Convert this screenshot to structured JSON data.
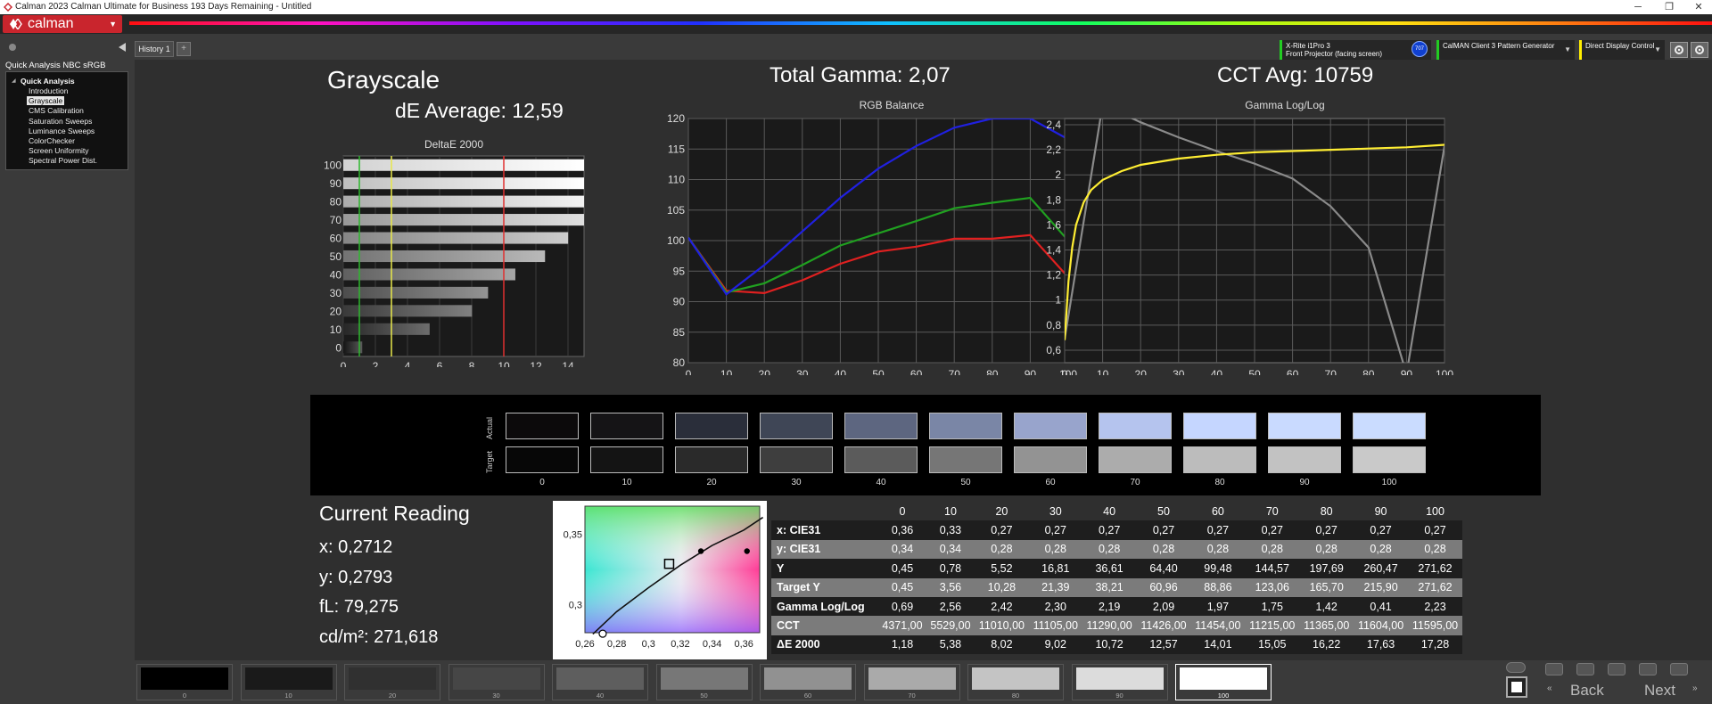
{
  "window": {
    "title": "Calman 2023 Calman Ultimate for Business 193 Days Remaining  - Untitled",
    "minimize": "─",
    "restore": "❐",
    "close": "✕"
  },
  "logo": {
    "text": "calman"
  },
  "left_panel": {
    "section_title": "Quick Analysis NBC sRGB",
    "tree_root": "Quick Analysis",
    "items": [
      {
        "label": "Introduction",
        "selected": false
      },
      {
        "label": "Grayscale",
        "selected": true
      },
      {
        "label": "CMS Calibration",
        "selected": false
      },
      {
        "label": "Saturation Sweeps",
        "selected": false
      },
      {
        "label": "Luminance Sweeps",
        "selected": false
      },
      {
        "label": "ColorChecker",
        "selected": false
      },
      {
        "label": "Screen Uniformity",
        "selected": false
      },
      {
        "label": "Spectral Power Dist.",
        "selected": false
      }
    ]
  },
  "history": {
    "tab_label": "History 1",
    "add_label": "+"
  },
  "devices": {
    "meter_line1": "X-Rite i1Pro 3",
    "meter_line2": "Front Projector (facing screen)",
    "meter_badge": "707",
    "generator": "CalMAN Client 3 Pattern Generator",
    "display": "Direct Display Control"
  },
  "header": {
    "page_title": "Grayscale",
    "de_average": "dE Average: 12,59",
    "total_gamma": "Total Gamma: 2,07",
    "cct_avg": "CCT Avg: 10759"
  },
  "chart_data": [
    {
      "type": "bar",
      "title": "DeltaE 2000",
      "orientation": "horizontal",
      "categories": [
        "100",
        "90",
        "80",
        "70",
        "60",
        "50",
        "40",
        "30",
        "20",
        "10",
        "0"
      ],
      "values": [
        17.28,
        17.63,
        16.22,
        15.05,
        14.01,
        12.57,
        10.72,
        9.02,
        8.02,
        5.38,
        1.18
      ],
      "xlim": [
        0,
        15
      ],
      "x_ticks": [
        "0",
        "2",
        "4",
        "6",
        "8",
        "10",
        "12",
        "14"
      ],
      "reference_lines": [
        {
          "value": 1,
          "color": "#2db82d"
        },
        {
          "value": 3,
          "color": "#e8e84a"
        },
        {
          "value": 10,
          "color": "#e03030"
        }
      ]
    },
    {
      "type": "line",
      "title": "RGB Balance",
      "x": [
        0,
        10,
        20,
        30,
        40,
        50,
        60,
        70,
        80,
        90,
        100
      ],
      "ylim": [
        80,
        120
      ],
      "x_ticks": [
        "0",
        "10",
        "20",
        "30",
        "40",
        "50",
        "60",
        "70",
        "80",
        "90",
        "100"
      ],
      "y_ticks": [
        "80",
        "85",
        "90",
        "95",
        "100",
        "105",
        "110",
        "115",
        "120"
      ],
      "series": [
        {
          "color": "#e02020",
          "values": [
            100.5,
            91.8,
            91.4,
            93.5,
            96.2,
            98.2,
            99.0,
            100.3,
            100.3,
            100.9,
            94.0
          ]
        },
        {
          "color": "#20a020",
          "values": [
            100.5,
            91.5,
            93.0,
            96.0,
            99.2,
            101.2,
            103.2,
            105.3,
            106.2,
            107.0,
            100.0
          ]
        },
        {
          "color": "#2020e0",
          "values": [
            100.5,
            91.2,
            96.0,
            101.5,
            107.0,
            111.8,
            115.5,
            118.5,
            120.0,
            120.0,
            116.6
          ]
        }
      ]
    },
    {
      "type": "line",
      "title": "Gamma Log/Log",
      "x": [
        0,
        10,
        20,
        30,
        40,
        50,
        60,
        70,
        80,
        90,
        100
      ],
      "ylim": [
        0.5,
        2.45
      ],
      "x_ticks": [
        "0",
        "10",
        "20",
        "30",
        "40",
        "50",
        "60",
        "70",
        "80",
        "90",
        "100"
      ],
      "y_ticks": [
        "0,6",
        "0,8",
        "1",
        "1,2",
        "1,4",
        "1,6",
        "1,8",
        "2",
        "2,2",
        "2,4"
      ],
      "series": [
        {
          "color": "#8a8a8a",
          "values": [
            0.69,
            2.56,
            2.42,
            2.3,
            2.19,
            2.09,
            1.97,
            1.75,
            1.42,
            0.41,
            2.23
          ]
        },
        {
          "color": "#ffee33",
          "x": [
            0,
            1,
            2,
            3,
            5,
            7,
            10,
            15,
            20,
            30,
            40,
            50,
            60,
            70,
            80,
            90,
            100
          ],
          "values": [
            0.68,
            1.15,
            1.42,
            1.6,
            1.78,
            1.88,
            1.96,
            2.03,
            2.08,
            2.13,
            2.16,
            2.18,
            2.19,
            2.2,
            2.21,
            2.22,
            2.24
          ]
        }
      ]
    },
    {
      "type": "scatter",
      "title": "CIE xy",
      "xlim": [
        0.26,
        0.37
      ],
      "ylim": [
        0.28,
        0.37
      ],
      "x_ticks": [
        "0,26",
        "0,28",
        "0,3",
        "0,32",
        "0,34",
        "0,36"
      ],
      "y_ticks": [
        "0,3",
        "0,35"
      ],
      "points": [
        {
          "x": 0.2712,
          "y": 0.2793,
          "marker": "circle-open"
        },
        {
          "x": 0.313,
          "y": 0.329,
          "marker": "square-open"
        },
        {
          "x": 0.333,
          "y": 0.338,
          "marker": "dot"
        },
        {
          "x": 0.362,
          "y": 0.338,
          "marker": "dot"
        }
      ]
    }
  ],
  "swatches": {
    "actual_label": "Actual",
    "target_label": "Target",
    "levels": [
      "0",
      "10",
      "20",
      "30",
      "40",
      "50",
      "60",
      "70",
      "80",
      "90",
      "100"
    ],
    "actual_colors": [
      "#0c0a0b",
      "#151416",
      "#2a2e3a",
      "#3f4656",
      "#5d6680",
      "#7a86a6",
      "#98a4cc",
      "#b5c4ee",
      "#c5d6ff",
      "#c9daff",
      "#cadcff"
    ],
    "target_colors": [
      "#070707",
      "#141414",
      "#2a2a2a",
      "#3e3e3e",
      "#5b5b5b",
      "#767676",
      "#939393",
      "#acacac",
      "#bcbcbc",
      "#c2c2c2",
      "#c9c9c9"
    ]
  },
  "current_reading": {
    "title": "Current Reading",
    "x": "x: 0,2712",
    "y": "y: 0,2793",
    "fl": "fL: 79,275",
    "cdm2": "cd/m²: 271,618"
  },
  "table": {
    "columns": [
      "0",
      "10",
      "20",
      "30",
      "40",
      "50",
      "60",
      "70",
      "80",
      "90",
      "100"
    ],
    "rows": [
      {
        "label": "x: CIE31",
        "values": [
          "0,36",
          "0,33",
          "0,27",
          "0,27",
          "0,27",
          "0,27",
          "0,27",
          "0,27",
          "0,27",
          "0,27",
          "0,27"
        ]
      },
      {
        "label": "y: CIE31",
        "values": [
          "0,34",
          "0,34",
          "0,28",
          "0,28",
          "0,28",
          "0,28",
          "0,28",
          "0,28",
          "0,28",
          "0,28",
          "0,28"
        ]
      },
      {
        "label": "Y",
        "values": [
          "0,45",
          "0,78",
          "5,52",
          "16,81",
          "36,61",
          "64,40",
          "99,48",
          "144,57",
          "197,69",
          "260,47",
          "271,62"
        ]
      },
      {
        "label": "Target Y",
        "values": [
          "0,45",
          "3,56",
          "10,28",
          "21,39",
          "38,21",
          "60,96",
          "88,86",
          "123,06",
          "165,70",
          "215,90",
          "271,62"
        ]
      },
      {
        "label": "Gamma Log/Log",
        "values": [
          "0,69",
          "2,56",
          "2,42",
          "2,30",
          "2,19",
          "2,09",
          "1,97",
          "1,75",
          "1,42",
          "0,41",
          "2,23"
        ]
      },
      {
        "label": "CCT",
        "values": [
          "4371,00",
          "5529,00",
          "11010,00",
          "11105,00",
          "11290,00",
          "11426,00",
          "11454,00",
          "11215,00",
          "11365,00",
          "11604,00",
          "11595,00"
        ]
      },
      {
        "label": "ΔE 2000",
        "values": [
          "1,18",
          "5,38",
          "8,02",
          "9,02",
          "10,72",
          "12,57",
          "14,01",
          "15,05",
          "16,22",
          "17,63",
          "17,28"
        ]
      }
    ]
  },
  "bottom": {
    "swatch_labels": [
      "0",
      "10",
      "20",
      "30",
      "40",
      "50",
      "60",
      "70",
      "80",
      "90",
      "100"
    ],
    "swatch_colors": [
      "#000000",
      "#1a1a1a",
      "#303030",
      "#464646",
      "#5e5e5e",
      "#777777",
      "#919191",
      "#aaaaaa",
      "#c4c4c4",
      "#dcdcdc",
      "#ffffff"
    ],
    "active_index": 10,
    "back_label": "Back",
    "next_label": "Next"
  }
}
